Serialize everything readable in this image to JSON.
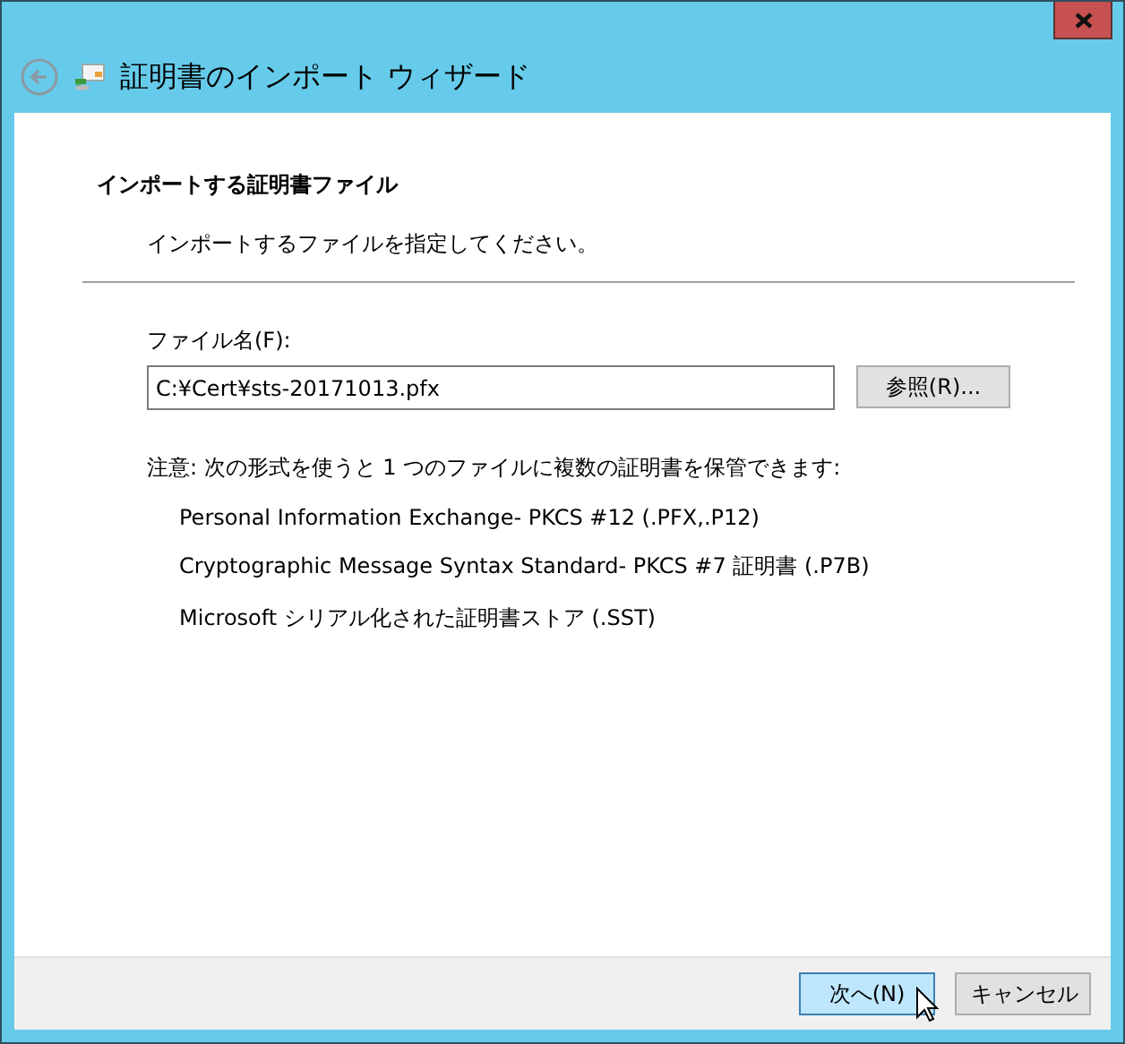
{
  "window": {
    "title": "証明書のインポート ウィザード"
  },
  "page": {
    "heading": "インポートする証明書ファイル",
    "subtitle": "インポートするファイルを指定してください。"
  },
  "file": {
    "label": "ファイル名(F):",
    "value": "C:¥Cert¥sts-20171013.pfx",
    "browse": "参照(R)..."
  },
  "note": {
    "text": "注意: 次の形式を使うと 1 つのファイルに複数の証明書を保管できます:",
    "formats": [
      "Personal Information Exchange- PKCS #12 (.PFX,.P12)",
      "Cryptographic Message Syntax Standard- PKCS #7 証明書 (.P7B)",
      "Microsoft シリアル化された証明書ストア (.SST)"
    ]
  },
  "buttons": [
    {
      "label": "次へ(N)",
      "hovered": true
    },
    {
      "label": "キャンセル",
      "hovered": false
    }
  ]
}
